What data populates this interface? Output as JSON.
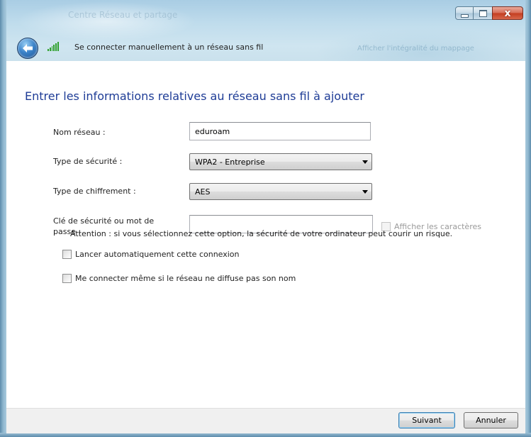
{
  "window": {
    "background_title": "Centre Réseau et partage",
    "background_right_text": "Afficher l'intégralité du mappage",
    "controls": {
      "minimize": "minimize",
      "maximize": "maximize",
      "close": "x"
    }
  },
  "nav": {
    "title": "Se connecter manuellement à un réseau sans fil"
  },
  "form": {
    "heading": "Entrer les informations relatives au réseau sans fil à ajouter",
    "network_name_label": "Nom réseau :",
    "network_name_value": "eduroam",
    "security_type_label": "Type de sécurité :",
    "security_type_value": "WPA2 - Entreprise",
    "encryption_type_label": "Type de chiffrement :",
    "encryption_type_value": "AES",
    "security_key_label": "Clé de sécurité ou mot de passe :",
    "security_key_value": "",
    "show_characters_label": "Afficher les caractères",
    "auto_start_label": "Lancer automatiquement cette connexion",
    "connect_hidden_label": "Me connecter même si le réseau ne diffuse pas son nom",
    "warning_text": "Attention : si vous sélectionnez cette option, la sécurité de votre ordinateur peut courir un risque."
  },
  "footer": {
    "next_label": "Suivant",
    "cancel_label": "Annuler"
  },
  "colors": {
    "heading": "#1e3c96",
    "glass": "#bfdcec",
    "close_button": "#c43d1f"
  }
}
